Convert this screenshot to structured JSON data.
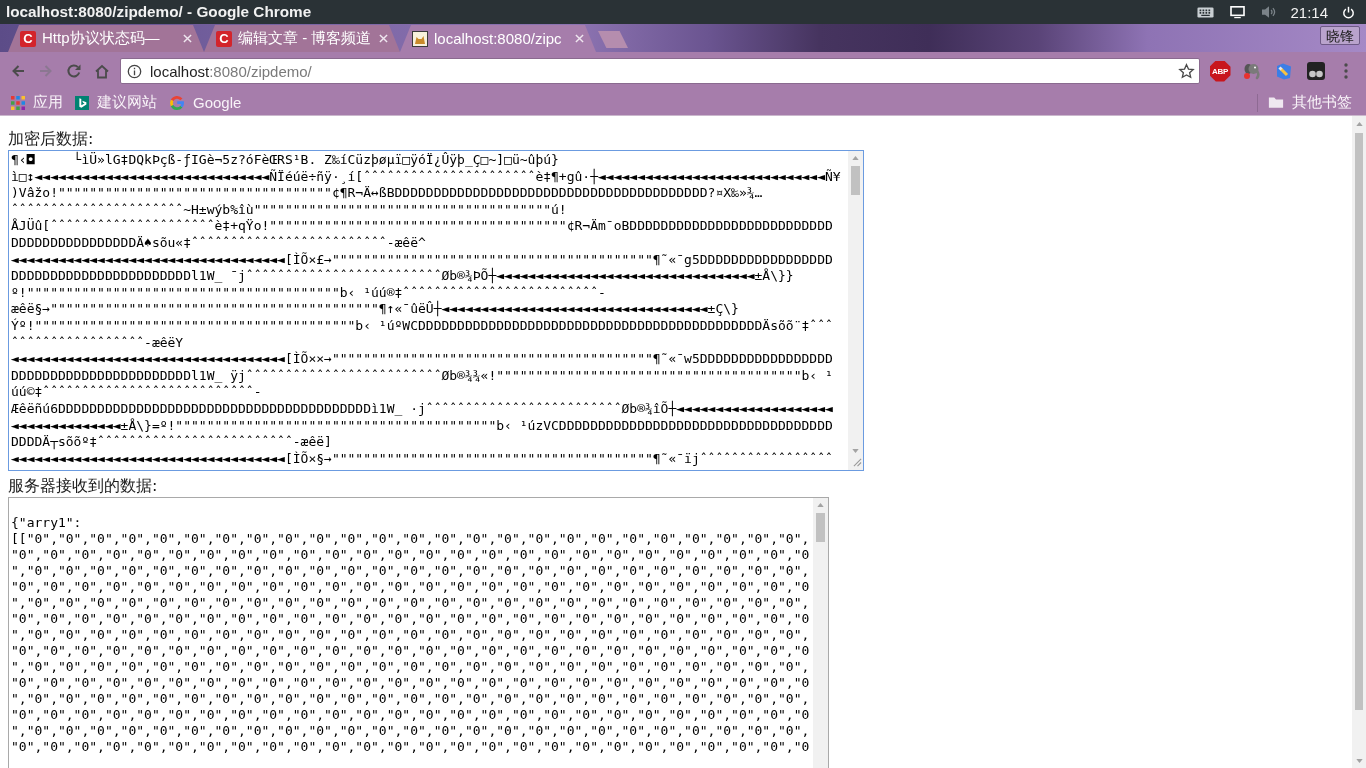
{
  "window": {
    "title": "localhost:8080/zipdemo/ - Google Chrome"
  },
  "system_tray": {
    "clock": "21:14"
  },
  "tabs": [
    {
      "title": "Http协议状态码—",
      "favicon": {
        "kind": "letter",
        "text": "C"
      },
      "selected": false
    },
    {
      "title": "编辑文章 - 博客频道",
      "favicon": {
        "kind": "letter",
        "text": "C"
      },
      "selected": false
    },
    {
      "title": "localhost:8080/zipc",
      "favicon": {
        "kind": "cat"
      },
      "selected": true
    }
  ],
  "profile": {
    "name": "晓锋"
  },
  "toolbar": {
    "nav": [
      {
        "kind": "back",
        "disabled": false
      },
      {
        "kind": "forward",
        "disabled": true
      },
      {
        "kind": "reload",
        "disabled": false
      },
      {
        "kind": "home",
        "disabled": false
      }
    ],
    "address": {
      "host": "localhost",
      "path": ":8080/zipdemo/"
    },
    "extensions": [
      {
        "kind": "badge",
        "text": "ABP"
      },
      {
        "kind": "elephant"
      },
      {
        "kind": "pencil"
      },
      {
        "kind": "circles"
      }
    ]
  },
  "bookmarks": {
    "items": [
      {
        "kind": "apps",
        "label": "应用"
      },
      {
        "kind": "tile",
        "label": "建议网站"
      },
      {
        "kind": "g",
        "label": "Google"
      }
    ],
    "other": {
      "label": "其他书签"
    }
  },
  "page": {
    "fields": [
      {
        "label": "加密后数据:",
        "focused": true,
        "lines": [
          "¶‹◘     └ìÜ»lG‡DQkÞçß-ƒIGè¬5z?óFèŒRS¹B. Z‰íCüzþøµï□ÿóÏ¿Ûÿþ_Ç□~]□ü~ûþú}",
          "ì□↕◄◄◄◄◄◄◄◄◄◄◄◄◄◄◄◄◄◄◄◄◄◄◄◄◄◄◄◄◄◄ÑÏéúë÷ñÿ·¸í[ˆˆˆˆˆˆˆˆˆˆˆˆˆˆˆˆˆˆˆˆˆˆè‡¶+gû·┼◄◄◄◄◄◄◄◄◄◄◄◄◄◄◄◄◄◄◄◄◄◄◄◄◄◄◄◄◄Ñ¥",
          ")Vâžo!\"\"\"\"\"\"\"\"\"\"\"\"\"\"\"\"\"\"\"\"\"\"\"\"\"\"\"\"\"\"\"\"\"\"\"¢¶R¬Ä↔ßBDDDDDDDDDDDDDDDDDDDDDDDDDDDDDDDDDDDDDDDD?¤X‰»¾…",
          "ˆˆˆˆˆˆˆˆˆˆˆˆˆˆˆˆˆˆˆˆˆˆ~H±wýb%îù\"\"\"\"\"\"\"\"\"\"\"\"\"\"\"\"\"\"\"\"\"\"\"\"\"\"\"\"\"\"\"\"\"\"\"\"\"\"ú!",
          "ÅJÜû[ˆˆˆˆˆˆˆˆˆˆˆˆˆˆˆˆˆˆˆˆˆè‡+qŸo!\"\"\"\"\"\"\"\"\"\"\"\"\"\"\"\"\"\"\"\"\"\"\"\"\"\"\"\"\"\"\"\"\"\"\"\"\"\"¢R¬Äm¯oBDDDDDDDDDDDDDDDDDDDDDDDDDD",
          "DDDDDDDDDDDDDDDDÄ♠sõu«‡ˆˆˆˆˆˆˆˆˆˆˆˆˆˆˆˆˆˆˆˆˆˆˆˆˆ-æêë^",
          "◄◄◄◄◄◄◄◄◄◄◄◄◄◄◄◄◄◄◄◄◄◄◄◄◄◄◄◄◄◄◄◄◄◄◄[ÌÕ×£→\"\"\"\"\"\"\"\"\"\"\"\"\"\"\"\"\"\"\"\"\"\"\"\"\"\"\"\"\"\"\"\"\"\"\"\"\"\"\"\"\"¶˜«¯g5DDDDDDDDDDDDDDDDD",
          "DDDDDDDDDDDDDDDDDDDDDDDl1W_ ¯jˆˆˆˆˆˆˆˆˆˆˆˆˆˆˆˆˆˆˆˆˆˆˆˆˆØb®¾ÞÕ┼◄◄◄◄◄◄◄◄◄◄◄◄◄◄◄◄◄◄◄◄◄◄◄◄◄◄◄◄◄◄◄◄◄±Å\\}}",
          "º!\"\"\"\"\"\"\"\"\"\"\"\"\"\"\"\"\"\"\"\"\"\"\"\"\"\"\"\"\"\"\"\"\"\"\"\"\"\"\"\"b‹ ¹úú®‡ˆˆˆˆˆˆˆˆˆˆˆˆˆˆˆˆˆˆˆˆˆˆˆˆˆ-",
          "æêë§→\"\"\"\"\"\"\"\"\"\"\"\"\"\"\"\"\"\"\"\"\"\"\"\"\"\"\"\"\"\"\"\"\"\"\"\"\"\"\"\"\"\"¶↑«¯ûëÛ┼◄◄◄◄◄◄◄◄◄◄◄◄◄◄◄◄◄◄◄◄◄◄◄◄◄◄◄◄◄◄◄◄◄◄±Ç\\}",
          "Ýº!\"\"\"\"\"\"\"\"\"\"\"\"\"\"\"\"\"\"\"\"\"\"\"\"\"\"\"\"\"\"\"\"\"\"\"\"\"\"\"\"\"b‹ ¹úºWCDDDDDDDDDDDDDDDDDDDDDDDDDDDDDDDDDDDDDDDDDDDDÄsõõ¨‡ˆˆˆ",
          "ˆˆˆˆˆˆˆˆˆˆˆˆˆˆˆˆˆ-æêëY",
          "◄◄◄◄◄◄◄◄◄◄◄◄◄◄◄◄◄◄◄◄◄◄◄◄◄◄◄◄◄◄◄◄◄◄◄[ÌÕ××→\"\"\"\"\"\"\"\"\"\"\"\"\"\"\"\"\"\"\"\"\"\"\"\"\"\"\"\"\"\"\"\"\"\"\"\"\"\"\"\"\"¶˜«¯w5DDDDDDDDDDDDDDDDD",
          "DDDDDDDDDDDDDDDDDDDDDDDl1W_ ÿjˆˆˆˆˆˆˆˆˆˆˆˆˆˆˆˆˆˆˆˆˆˆˆˆˆØb®¾¾«!\"\"\"\"\"\"\"\"\"\"\"\"\"\"\"\"\"\"\"\"\"\"\"\"\"\"\"\"\"\"\"\"\"\"\"\"\"\"\"b‹ ¹",
          "úú©‡ˆˆˆˆˆˆˆˆˆˆˆˆˆˆˆˆˆˆˆˆˆˆˆˆˆˆˆ-",
          "Æêëñú6DDDDDDDDDDDDDDDDDDDDDDDDDDDDDDDDDDDDDDDDì1W_ ·jˆˆˆˆˆˆˆˆˆˆˆˆˆˆˆˆˆˆˆˆˆˆˆˆˆØb®¾îÕ┼◄◄◄◄◄◄◄◄◄◄◄◄◄◄◄◄◄◄◄◄",
          "◄◄◄◄◄◄◄◄◄◄◄◄◄◄±Å\\}=º!\"\"\"\"\"\"\"\"\"\"\"\"\"\"\"\"\"\"\"\"\"\"\"\"\"\"\"\"\"\"\"\"\"\"\"\"\"\"\"\"\"b‹ ¹úzVCDDDDDDDDDDDDDDDDDDDDDDDDDDDDDDDDDDD",
          "DDDDÄ┬sõõº‡ˆˆˆˆˆˆˆˆˆˆˆˆˆˆˆˆˆˆˆˆˆˆˆˆˆ-æêë]",
          "◄◄◄◄◄◄◄◄◄◄◄◄◄◄◄◄◄◄◄◄◄◄◄◄◄◄◄◄◄◄◄◄◄◄◄[ÌÕ×§→\"\"\"\"\"\"\"\"\"\"\"\"\"\"\"\"\"\"\"\"\"\"\"\"\"\"\"\"\"\"\"\"\"\"\"\"\"\"\"\"\"¶˜«¯ïjˆˆˆˆˆˆˆˆˆˆˆˆˆˆˆˆˆ"
        ]
      },
      {
        "label": "服务器接收到的数据:",
        "focused": false,
        "lines": [
          "{\"arry1\":",
          "[[\"0\",\"0\",\"0\",\"0\",\"0\",\"0\",\"0\",\"0\",\"0\",\"0\",\"0\",\"0\",\"0\",\"0\",\"0\",\"0\",\"0\",\"0\",\"0\",\"0\",\"0\",\"0\",\"0\",\"0\",\"0\",",
          "\"0\",\"0\",\"0\",\"0\",\"0\",\"0\",\"0\",\"0\",\"0\",\"0\",\"0\",\"0\",\"0\",\"0\",\"0\",\"0\",\"0\",\"0\",\"0\",\"0\",\"0\",\"0\",\"0\",\"0\",\"0\",\"0",
          "\",\"0\",\"0\",\"0\",\"0\",\"0\",\"0\",\"0\",\"0\",\"0\",\"0\",\"0\",\"0\",\"0\",\"0\",\"0\",\"0\",\"0\",\"0\",\"0\",\"0\",\"0\",\"0\",\"0\",\"0\",\"0\",",
          "\"0\",\"0\",\"0\",\"0\",\"0\",\"0\",\"0\",\"0\",\"0\",\"0\",\"0\",\"0\",\"0\",\"0\",\"0\",\"0\",\"0\",\"0\",\"0\",\"0\",\"0\",\"0\",\"0\",\"0\",\"0\",\"0",
          "\",\"0\",\"0\",\"0\",\"0\",\"0\",\"0\",\"0\",\"0\",\"0\",\"0\",\"0\",\"0\",\"0\",\"0\",\"0\",\"0\",\"0\",\"0\",\"0\",\"0\",\"0\",\"0\",\"0\",\"0\",\"0\",",
          "\"0\",\"0\",\"0\",\"0\",\"0\",\"0\",\"0\",\"0\",\"0\",\"0\",\"0\",\"0\",\"0\",\"0\",\"0\",\"0\",\"0\",\"0\",\"0\",\"0\",\"0\",\"0\",\"0\",\"0\",\"0\",\"0",
          "\",\"0\",\"0\",\"0\",\"0\",\"0\",\"0\",\"0\",\"0\",\"0\",\"0\",\"0\",\"0\",\"0\",\"0\",\"0\",\"0\",\"0\",\"0\",\"0\",\"0\",\"0\",\"0\",\"0\",\"0\",\"0\",",
          "\"0\",\"0\",\"0\",\"0\",\"0\",\"0\",\"0\",\"0\",\"0\",\"0\",\"0\",\"0\",\"0\",\"0\",\"0\",\"0\",\"0\",\"0\",\"0\",\"0\",\"0\",\"0\",\"0\",\"0\",\"0\",\"0",
          "\",\"0\",\"0\",\"0\",\"0\",\"0\",\"0\",\"0\",\"0\",\"0\",\"0\",\"0\",\"0\",\"0\",\"0\",\"0\",\"0\",\"0\",\"0\",\"0\",\"0\",\"0\",\"0\",\"0\",\"0\",\"0\",",
          "\"0\",\"0\",\"0\",\"0\",\"0\",\"0\",\"0\",\"0\",\"0\",\"0\",\"0\",\"0\",\"0\",\"0\",\"0\",\"0\",\"0\",\"0\",\"0\",\"0\",\"0\",\"0\",\"0\",\"0\",\"0\",\"0",
          "\",\"0\",\"0\",\"0\",\"0\",\"0\",\"0\",\"0\",\"0\",\"0\",\"0\",\"0\",\"0\",\"0\",\"0\",\"0\",\"0\",\"0\",\"0\",\"0\",\"0\",\"0\",\"0\",\"0\",\"0\",\"0\",",
          "\"0\",\"0\",\"0\",\"0\",\"0\",\"0\",\"0\",\"0\",\"0\",\"0\",\"0\",\"0\",\"0\",\"0\",\"0\",\"0\",\"0\",\"0\",\"0\",\"0\",\"0\",\"0\",\"0\",\"0\",\"0\",\"0",
          "\",\"0\",\"0\",\"0\",\"0\",\"0\",\"0\",\"0\",\"0\",\"0\",\"0\",\"0\",\"0\",\"0\",\"0\",\"0\",\"0\",\"0\",\"0\",\"0\",\"0\",\"0\",\"0\",\"0\",\"0\",\"0\",",
          "\"0\",\"0\",\"0\",\"0\",\"0\",\"0\",\"0\",\"0\",\"0\",\"0\",\"0\",\"0\",\"0\",\"0\",\"0\",\"0\",\"0\",\"0\",\"0\",\"0\",\"0\",\"0\",\"0\",\"0\",\"0\",\"0"
        ]
      }
    ]
  }
}
